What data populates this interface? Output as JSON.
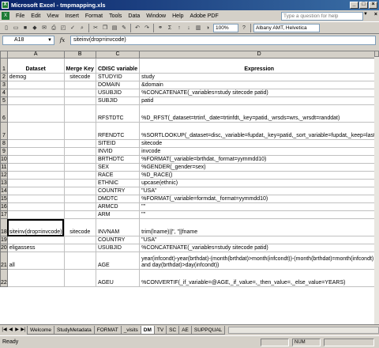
{
  "window": {
    "title": "Microsoft Excel - tmpmapping.xls",
    "app_icon": "excel-icon"
  },
  "menu": {
    "items": [
      "File",
      "Edit",
      "View",
      "Insert",
      "Format",
      "Tools",
      "Data",
      "Window",
      "Help",
      "Adobe PDF"
    ],
    "help_placeholder": "Type a question for help"
  },
  "toolbar": {
    "zoom": "100%",
    "font": "Albany AMT, Helvetica"
  },
  "formula_bar": {
    "name_box": "A18",
    "fx": "fx",
    "formula": "siteinv(drop=invcode)"
  },
  "grid": {
    "columns": [
      "A",
      "B",
      "C",
      "D"
    ],
    "header_row": [
      "Dataset",
      "Merge Key",
      "CDISC variable",
      "Expression"
    ],
    "rows": [
      {
        "n": "2",
        "a": "demog",
        "b": "sitecode",
        "c": "STUDYID",
        "d": "study"
      },
      {
        "n": "3",
        "a": "",
        "b": "",
        "c": "DOMAIN",
        "d": "&domain"
      },
      {
        "n": "4",
        "a": "",
        "b": "",
        "c": "USUBJID",
        "d": "%CONCATENATE(_variables=study sitecode patid)"
      },
      {
        "n": "5",
        "a": "",
        "b": "",
        "c": "SUBJID",
        "d": "patid"
      },
      {
        "n": "6",
        "a": "",
        "b": "",
        "c": "RFSTDTC",
        "d": "%D_RFST(_dataset=trtinf,_date=trtinfdt,_key=patid,_wrsds=wrs,_wrsdt=randdat)"
      },
      {
        "n": "7",
        "a": "",
        "b": "",
        "c": "RFENDTC",
        "d": "%SORTLOOKUP(_dataset=disc,_variable=fupdat,_key=patid,_sort_variable=fupdat,_keep=last)"
      },
      {
        "n": "8",
        "a": "",
        "b": "",
        "c": "SITEID",
        "d": "sitecode"
      },
      {
        "n": "9",
        "a": "",
        "b": "",
        "c": "INVID",
        "d": "invcode"
      },
      {
        "n": "10",
        "a": "",
        "b": "",
        "c": "BRTHDTC",
        "d": "%FORMAT(_variable=brthdat,_format=yymmdd10)"
      },
      {
        "n": "11",
        "a": "",
        "b": "",
        "c": "SEX",
        "d": "%GENDER(_gender=sex)"
      },
      {
        "n": "12",
        "a": "",
        "b": "",
        "c": "RACE",
        "d": "%D_RACE()"
      },
      {
        "n": "13",
        "a": "",
        "b": "",
        "c": "ETHNIC",
        "d": "upcase(ethnic)"
      },
      {
        "n": "14",
        "a": "",
        "b": "",
        "c": "COUNTRY",
        "d": "\"USA\""
      },
      {
        "n": "15",
        "a": "",
        "b": "",
        "c": "DMDTC",
        "d": "%FORMAT(_variable=formdat,_format=yymmdd10)"
      },
      {
        "n": "16",
        "a": "",
        "b": "",
        "c": "ARMCD",
        "d": "\"\""
      },
      {
        "n": "17",
        "a": "",
        "b": "",
        "c": "ARM",
        "d": "\"\""
      },
      {
        "n": "18",
        "a": "siteinv(drop=invcode)",
        "b": "sitecode",
        "c": "INVNAM",
        "d": "trim(lname)||\", \"||fname"
      },
      {
        "n": "19",
        "a": "",
        "b": "",
        "c": "COUNTRY",
        "d": "\"USA\""
      },
      {
        "n": "20",
        "a": "eligassess",
        "b": "",
        "c": "USUBJID",
        "d": "%CONCATENATE(_variables=study sitecode patid)"
      },
      {
        "n": "21",
        "a": "all",
        "b": "",
        "c": "AGE",
        "d": "year(infcondt)-year(brthdat)-(month(brthdat)>month(infcondt))-(month(brthdat)=month(infcondt) and day(brthdat)>day(infcondt))"
      },
      {
        "n": "22",
        "a": "",
        "b": "",
        "c": "AGEU",
        "d": "%CONVERTIF(_if_variable=@AGE,_if_value=,_then_value=,_else_value=YEARS)"
      }
    ]
  },
  "tabs": [
    "Welcome",
    "StudyMetadata",
    "FORMAT",
    "_visits",
    "DM",
    "TV",
    "SC",
    "AE",
    "SUPPQUAL"
  ],
  "active_tab": "DM",
  "status": {
    "text": "Ready",
    "num": "NUM"
  }
}
